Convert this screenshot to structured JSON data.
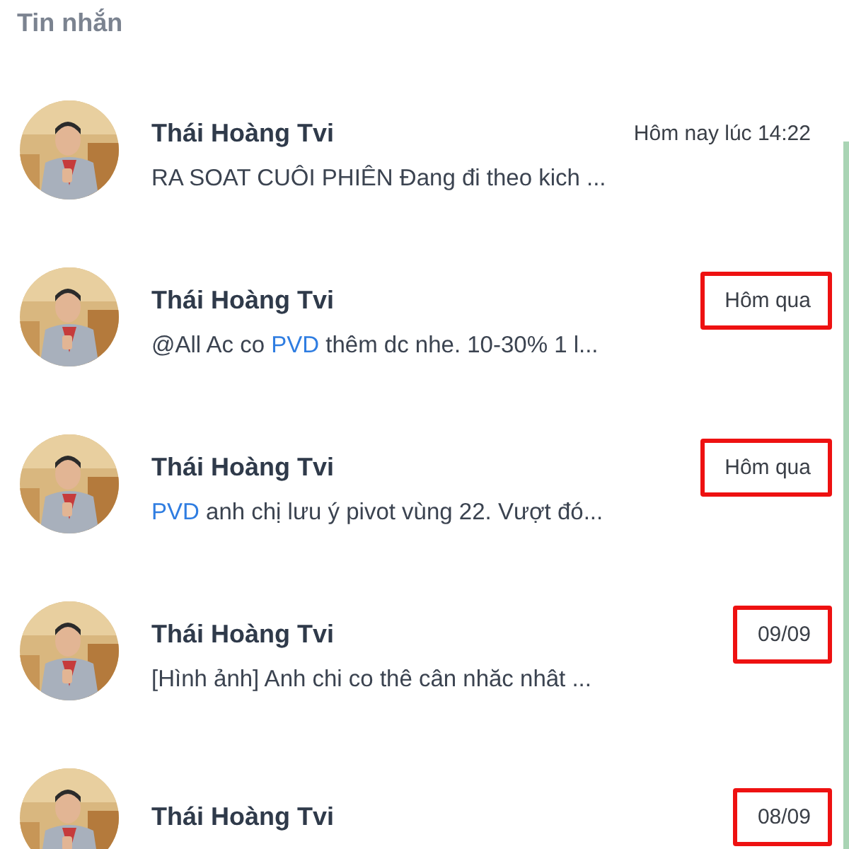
{
  "panel": {
    "title": "Tin nhắn"
  },
  "messages": [
    {
      "sender": "Thái Hoàng Tvi",
      "time": "Hôm nay lúc 14:22",
      "highlighted": false,
      "preview": [
        {
          "kind": "text",
          "text": "RA SOAT CUÔI PHIÊN Đang đi theo kich ..."
        }
      ]
    },
    {
      "sender": "Thái Hoàng Tvi",
      "time": "Hôm qua",
      "highlighted": true,
      "preview": [
        {
          "kind": "text",
          "text": "@All Ac co "
        },
        {
          "kind": "link",
          "text": "PVD"
        },
        {
          "kind": "text",
          "text": " thêm dc nhe. 10-30% 1 l..."
        }
      ]
    },
    {
      "sender": "Thái Hoàng Tvi",
      "time": "Hôm qua",
      "highlighted": true,
      "preview": [
        {
          "kind": "link",
          "text": "PVD"
        },
        {
          "kind": "text",
          "text": " anh chị lưu ý pivot vùng 22. Vượt đó..."
        }
      ]
    },
    {
      "sender": "Thái Hoàng Tvi",
      "time": "09/09",
      "highlighted": true,
      "preview": [
        {
          "kind": "text",
          "text": "[Hình ảnh] Anh chi co thê cân nhăc nhât ..."
        }
      ]
    },
    {
      "sender": "Thái Hoàng Tvi",
      "time": "08/09",
      "highlighted": true
    }
  ]
}
